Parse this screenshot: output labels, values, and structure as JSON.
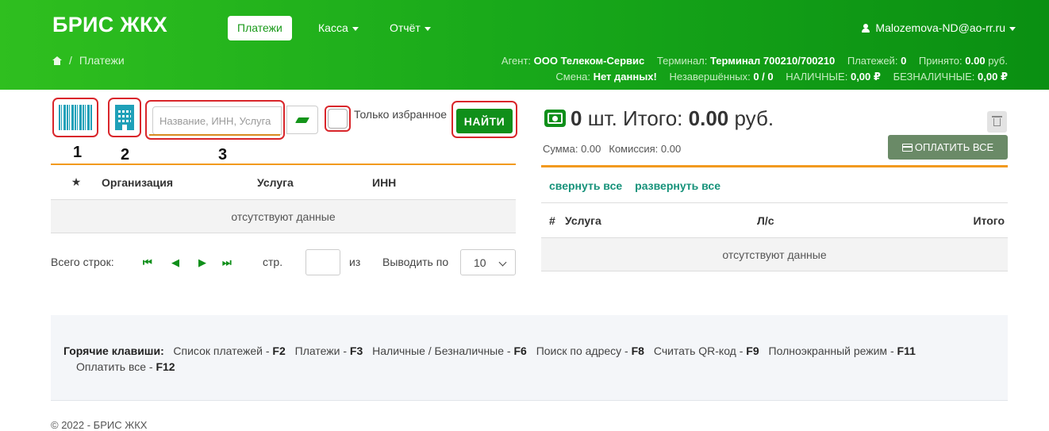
{
  "header": {
    "brand": "БРИС ЖКХ",
    "nav": {
      "payments": "Платежи",
      "cashbox": "Касса",
      "report": "Отчёт"
    },
    "user": "Malozemova-ND@ao-rr.ru",
    "breadcrumb": {
      "current": "Платежи",
      "separator": "/"
    },
    "info": {
      "agent_label": "Агент:",
      "agent_value": "ООО Телеком-Сервис",
      "terminal_label": "Терминал:",
      "terminal_value": "Терминал 700210/700210",
      "payments_label": "Платежей:",
      "payments_value": "0",
      "accepted_label": "Принято:",
      "accepted_value": "0.00",
      "accepted_unit": "руб.",
      "shift_label": "Смена:",
      "shift_value": "Нет данных!",
      "unfinished_label": "Незавершённых:",
      "unfinished_value": "0 / 0",
      "cash_label": "НАЛИЧНЫЕ:",
      "cash_value": "0,00 ₽",
      "cashless_label": "БЕЗНАЛИЧНЫЕ:",
      "cashless_value": "0,00 ₽"
    }
  },
  "search": {
    "placeholder": "Название, ИНН, Услуга",
    "favorites_label": "Только избранное",
    "find_label": "НАЙТИ"
  },
  "annotations": [
    "1",
    "2",
    "3"
  ],
  "left_table": {
    "columns": [
      "★",
      "Организация",
      "Услуга",
      "ИНН"
    ],
    "empty": "отсутствуют данные"
  },
  "pager": {
    "total_label": "Всего строк:",
    "page_label": "стр.",
    "of_label": "из",
    "per_page_label": "Выводить по",
    "per_page_value": "10",
    "first": "⏮",
    "prev": "◀",
    "next": "▶",
    "last": "⏭"
  },
  "cart": {
    "count": "0",
    "count_unit": "шт.",
    "total_label": "Итого:",
    "total_value": "0.00",
    "total_unit": "руб.",
    "sum_label": "Сумма: 0.00",
    "commission_label": "Комиссия: 0.00",
    "pay_all": "ОПЛАТИТЬ ВСЕ",
    "collapse_all": "свернуть все",
    "expand_all": "развернуть все",
    "columns": [
      "#",
      "Услуга",
      "Л/с",
      "Итого"
    ],
    "empty": "отсутствуют данные"
  },
  "hotkeys": {
    "title": "Горячие клавиши:",
    "items": [
      {
        "label": "Список платежей - ",
        "key": "F2"
      },
      {
        "label": "Платежи - ",
        "key": "F3"
      },
      {
        "label": "Наличные / Безналичные - ",
        "key": "F6"
      },
      {
        "label": "Поиск по адресу - ",
        "key": "F8"
      },
      {
        "label": "Считать QR-код - ",
        "key": "F9"
      },
      {
        "label": "Полноэкранный режим - ",
        "key": "F11"
      },
      {
        "label": "Оплатить все - ",
        "key": "F12"
      }
    ]
  },
  "footer": "© 2022 - БРИС ЖКХ",
  "colors": {
    "header_green": "#18a81a",
    "accent_green": "#108f1a",
    "teal": "#1fa0b8",
    "annotation_red": "#d9262b",
    "table_accent": "#f29a1e"
  }
}
